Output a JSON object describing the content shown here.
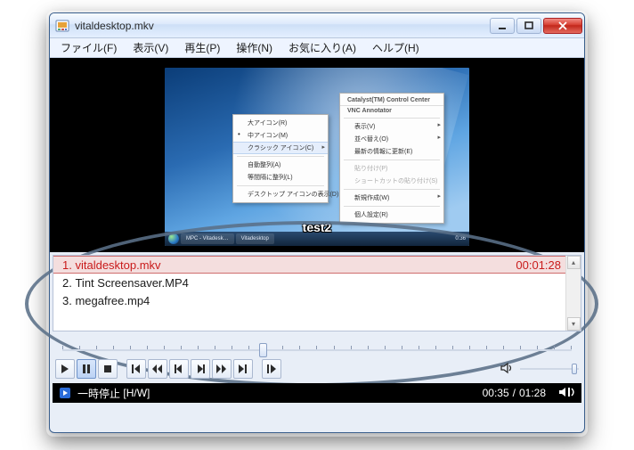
{
  "window": {
    "title": "vitaldesktop.mkv"
  },
  "menubar": {
    "items": [
      "ファイル(F)",
      "表示(V)",
      "再生(P)",
      "操作(N)",
      "お気に入り(A)",
      "ヘルプ(H)"
    ]
  },
  "video": {
    "subtitle": "test2",
    "context_left": {
      "items": [
        "大アイコン(R)",
        "中アイコン(M)",
        "クラシック アイコン(C)",
        "自動整列(A)",
        "等間隔に整列(L)",
        "デスクトップ アイコンの表示(D)"
      ],
      "highlighted_index": 2
    },
    "context_right": {
      "title_top": "Catalyst(TM) Control Center",
      "title_sub": "VNC Annotator",
      "items": [
        "表示(V)",
        "並べ替え(O)",
        "最新の情報に更新(E)",
        "貼り付け(P)",
        "ショートカットの貼り付け(S)",
        "新規作成(W)",
        "個人設定(R)"
      ]
    },
    "taskbar": {
      "items": [
        "MPC - Vitadesk…",
        "Vitadesktop"
      ],
      "time": "0:36"
    }
  },
  "playlist": {
    "items": [
      {
        "index": "1.",
        "name": "vitaldesktop.mkv",
        "duration": "00:01:28",
        "active": true
      },
      {
        "index": "2.",
        "name": "Tint Screensaver.MP4",
        "duration": "",
        "active": false
      },
      {
        "index": "3.",
        "name": "megafree.mp4",
        "duration": "",
        "active": false
      }
    ]
  },
  "status": {
    "state": "一時停止",
    "mode": "[H/W]",
    "time_current": "00:35",
    "time_total": "01:28",
    "sep": "/"
  }
}
